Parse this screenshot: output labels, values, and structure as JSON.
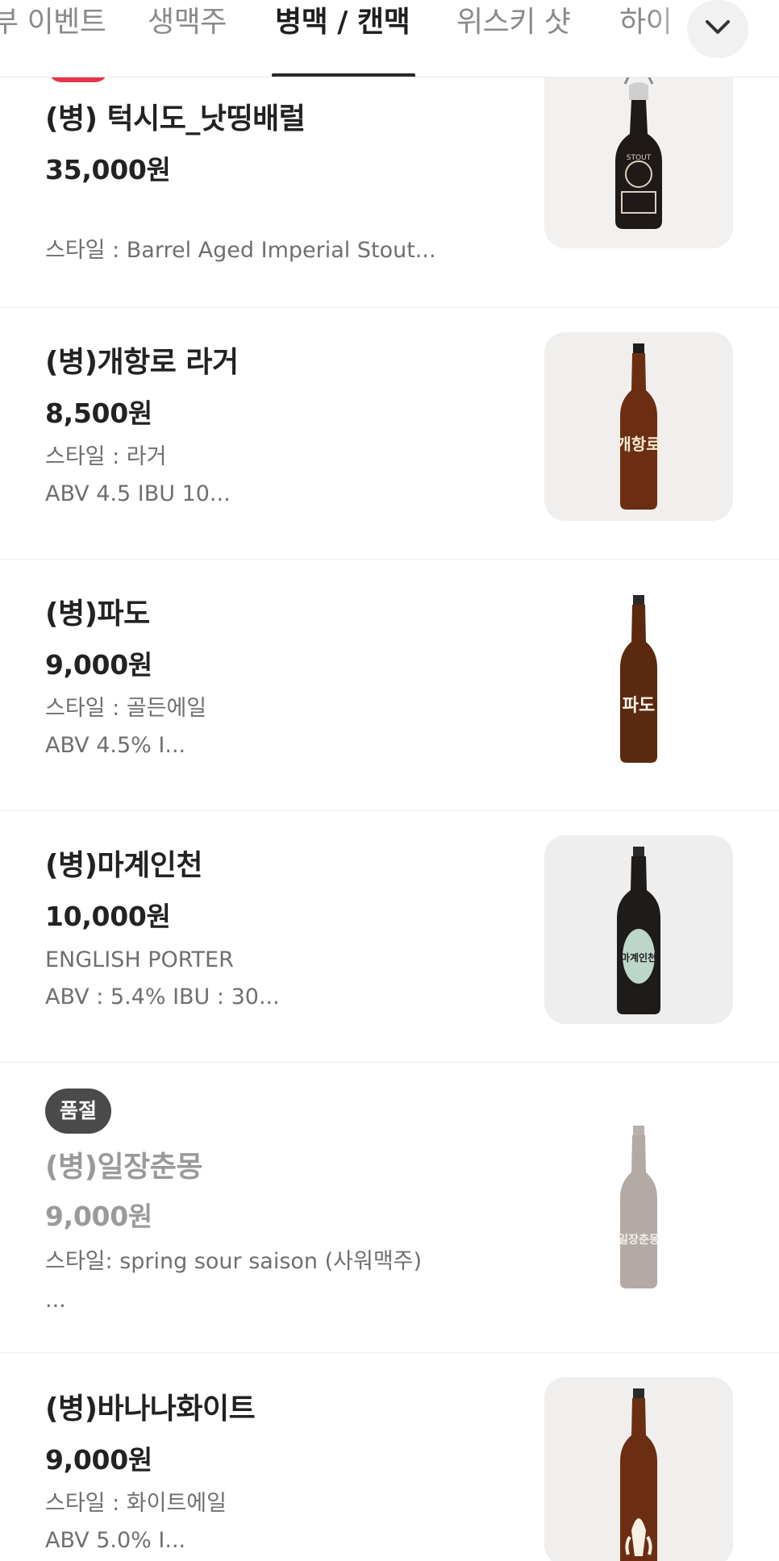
{
  "tabs": [
    {
      "label": "부 이벤트"
    },
    {
      "label": "생맥주"
    },
    {
      "label": "병맥 / 캔맥"
    },
    {
      "label": "위스키 샷"
    },
    {
      "label": "하이"
    }
  ],
  "products": [
    {
      "name": "(병) 턱시도_낫띵배럴",
      "price": "35,000원",
      "desc1": "스타일 : Barrel Aged Imperial Stout..."
    },
    {
      "name": "(병)개항로 라거",
      "price": "8,500원",
      "desc1": "스타일 : 라거",
      "desc2": "ABV 4.5  IBU 10...",
      "label": "개항로"
    },
    {
      "name": "(병)파도",
      "price": "9,000원",
      "desc1": "스타일 : 골든에일",
      "desc2": "ABV 4.5% I...",
      "label": "파도"
    },
    {
      "name": "(병)마계인천",
      "price": "10,000원",
      "desc1": "ENGLISH PORTER",
      "desc2": "ABV : 5.4%    IBU : 30...",
      "label": "마계인천"
    },
    {
      "badge": "품절",
      "name": "(병)일장춘몽",
      "price": "9,000원",
      "desc1": "스타일: spring sour saison (사워맥주)",
      "desc2": "...",
      "label": "일장춘몽"
    },
    {
      "name": "(병)바나나화이트",
      "price": "9,000원",
      "desc1": "스타일 : 화이트에일",
      "desc2": " ABV 5.0% I..."
    }
  ],
  "colors": {
    "accent_red": "#e8344a",
    "badge_bg": "#4a4a4a",
    "active_tab": "#1f1f1f"
  },
  "icons": {
    "expand": "chevron-down-icon"
  }
}
